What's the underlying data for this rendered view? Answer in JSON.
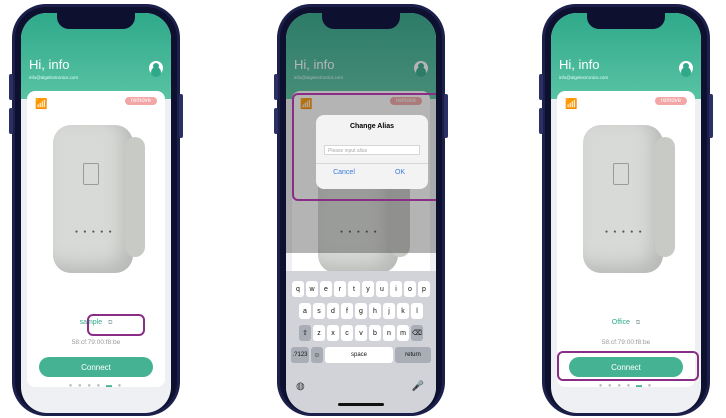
{
  "phones": [
    {
      "greeting": "Hi,  info",
      "email": "info@algelectronics.com",
      "remove_label": "remove",
      "alias": "sample",
      "mac": "58:cf:79:00:f8:be",
      "connect_label": "Connect"
    },
    {
      "greeting": "Hi,  info",
      "email": "info@algelectronics.com",
      "remove_label": "remove",
      "dialog": {
        "title": "Change Alias",
        "placeholder": "Please input alias",
        "cancel": "Cancel",
        "ok": "OK"
      },
      "keyboard": {
        "row1": [
          "q",
          "w",
          "e",
          "r",
          "t",
          "y",
          "u",
          "i",
          "o",
          "p"
        ],
        "row2": [
          "a",
          "s",
          "d",
          "f",
          "g",
          "h",
          "j",
          "k",
          "l"
        ],
        "row3": [
          "z",
          "x",
          "c",
          "v",
          "b",
          "n",
          "m"
        ],
        "num_key": ".?123",
        "space": "space",
        "return": "return"
      }
    },
    {
      "greeting": "Hi,  info",
      "email": "info@algelectronics.com",
      "remove_label": "remove",
      "alias": "Office",
      "mac": "58:cf:79:00:f8:be",
      "connect_label": "Connect"
    }
  ],
  "colors": {
    "accent": "#2fa98a",
    "connect_button": "#45b393",
    "remove_badge": "#f2a6a6",
    "highlight_border": "#8a2d86"
  }
}
